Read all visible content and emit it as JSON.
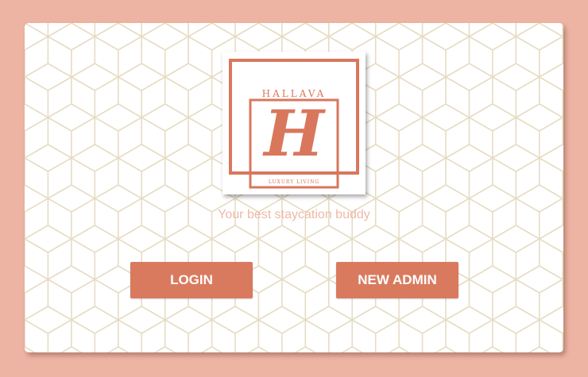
{
  "logo": {
    "brand": "HALLAVA",
    "monogram": "H",
    "sub": "LUXURY LIVING",
    "accent_color": "#d9775d"
  },
  "tagline": "Your best staycation buddy",
  "buttons": {
    "login_label": "LOGIN",
    "new_admin_label": "NEW ADMIN"
  },
  "colors": {
    "page_background": "#edb4a3",
    "button": "#d97a5f",
    "tagline": "#efb8a6",
    "pattern_line": "#e6dcc4"
  }
}
